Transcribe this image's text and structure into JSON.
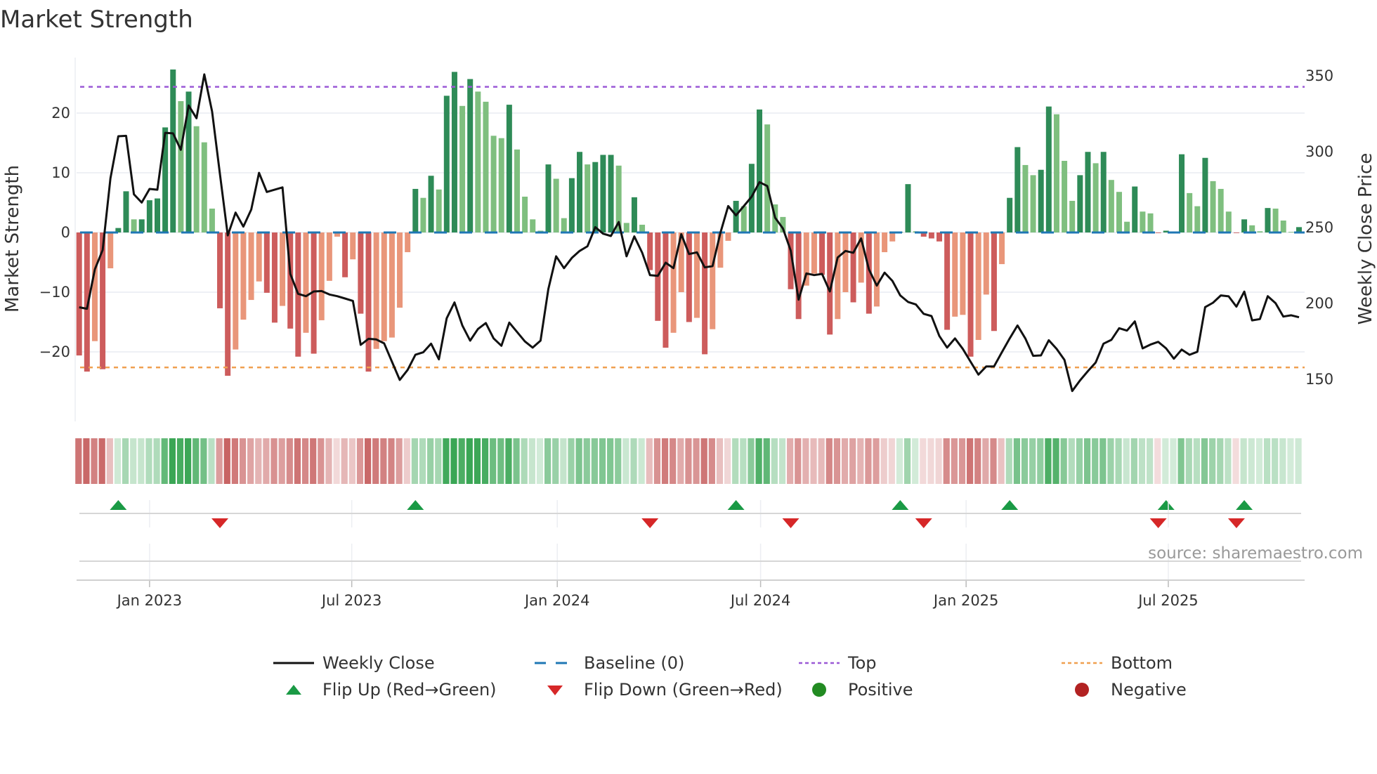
{
  "title": "Market Strength",
  "chart_data": {
    "type": "bar+line",
    "title": "Market Strength",
    "ylabel": "Market Strength",
    "y2label": "Weekly Close Price",
    "ylim": [
      -31.4,
      29.3
    ],
    "y2lim": [
      122.7,
      361.6
    ],
    "yticks": [
      {
        "v": 20,
        "label": "20"
      },
      {
        "v": 10,
        "label": "10"
      },
      {
        "v": 0,
        "label": "0"
      },
      {
        "v": -10,
        "label": "−10"
      },
      {
        "v": -20,
        "label": "−20"
      }
    ],
    "y2ticks": [
      {
        "v": 350,
        "label": "350"
      },
      {
        "v": 300,
        "label": "300"
      },
      {
        "v": 250,
        "label": "250"
      },
      {
        "v": 200,
        "label": "200"
      },
      {
        "v": 150,
        "label": "150"
      }
    ],
    "x_start": "2022-10-30",
    "x_step_days": 7,
    "xticks": [
      {
        "date": "2023-01-01",
        "label": "Jan 2023"
      },
      {
        "date": "2023-07-01",
        "label": "Jul 2023"
      },
      {
        "date": "2024-01-01",
        "label": "Jan 2024"
      },
      {
        "date": "2024-07-01",
        "label": "Jul 2024"
      },
      {
        "date": "2025-01-01",
        "label": "Jan 2025"
      },
      {
        "date": "2025-07-01",
        "label": "Jul 2025"
      }
    ],
    "top_level": 24.4,
    "bottom_level": -22.6,
    "baseline": 0,
    "strength": [
      -20.6,
      -23.3,
      -18.2,
      -22.9,
      -6.0,
      0.75,
      6.9,
      2.2,
      2.2,
      5.4,
      5.7,
      17.6,
      27.3,
      22.0,
      23.6,
      17.8,
      15.1,
      4.0,
      -12.7,
      -24.0,
      -19.6,
      -14.6,
      -11.3,
      -8.2,
      -10.1,
      -15.1,
      -12.3,
      -16.1,
      -20.8,
      -16.8,
      -20.3,
      -14.7,
      -8.1,
      -0.7,
      -7.5,
      -4.5,
      -13.6,
      -23.3,
      -19.5,
      -18.2,
      -17.6,
      -12.6,
      -3.3,
      7.3,
      5.8,
      9.5,
      7.2,
      22.9,
      26.9,
      21.2,
      25.7,
      23.6,
      21.9,
      16.2,
      15.8,
      21.4,
      13.9,
      6.0,
      2.2,
      0.3,
      11.4,
      9.0,
      2.4,
      9.1,
      13.5,
      11.4,
      11.8,
      13.0,
      13.0,
      11.2,
      1.6,
      5.9,
      1.3,
      -6.3,
      -14.8,
      -19.3,
      -16.8,
      -10.0,
      -15.0,
      -14.3,
      -20.4,
      -16.2,
      -5.9,
      -1.4,
      5.3,
      4.4,
      11.5,
      20.6,
      18.1,
      4.7,
      2.6,
      -9.5,
      -14.5,
      -8.9,
      -6.9,
      -7.1,
      -17.1,
      -14.5,
      -10.0,
      -11.7,
      -8.4,
      -13.6,
      -12.4,
      -3.3,
      -1.5,
      0.1,
      8.1,
      0.2,
      -0.7,
      -1.0,
      -1.5,
      -16.3,
      -14.1,
      -13.8,
      -20.8,
      -18.0,
      -10.4,
      -16.5,
      -5.3,
      5.8,
      14.3,
      11.3,
      9.6,
      10.5,
      21.1,
      19.8,
      12.0,
      5.3,
      9.6,
      13.5,
      11.6,
      13.5,
      8.8,
      6.8,
      1.8,
      7.7,
      3.5,
      3.2,
      -0.1,
      0.3,
      0.05,
      13.1,
      6.6,
      4.4,
      12.5,
      8.6,
      7.3,
      3.5,
      -0.1,
      2.2,
      1.2,
      0.2,
      4.1,
      4.0,
      2.0,
      0.1,
      0.9
    ],
    "weekly_close": [
      197,
      196,
      222,
      234.7,
      282,
      309.7,
      310,
      271.5,
      266,
      275,
      274.5,
      312,
      311.6,
      300.8,
      330,
      321.6,
      350.5,
      326,
      285,
      244.4,
      259.4,
      250.2,
      261.4,
      285.6,
      273,
      274.5,
      276,
      219,
      205.9,
      204.3,
      207.4,
      207.7,
      205.4,
      204.3,
      202.8,
      201.2,
      172.2,
      176.2,
      175.8,
      173.2,
      161.1,
      149.1,
      155.7,
      165.7,
      167.3,
      173,
      162.7,
      189.7,
      200.2,
      185,
      175,
      182.7,
      186.6,
      176.5,
      171.6,
      186.9,
      180.7,
      174.5,
      170.4,
      175,
      209,
      230.6,
      222.8,
      229.5,
      234.1,
      237.2,
      249.8,
      245.5,
      244,
      253.2,
      230.6,
      243.7,
      232.9,
      218.2,
      217.7,
      226.4,
      222.8,
      245.2,
      232.1,
      233.2,
      223.3,
      224.1,
      246,
      263.7,
      257.6,
      263.7,
      269.9,
      279.5,
      276.9,
      256,
      249,
      234.4,
      202,
      219.3,
      218.2,
      219,
      207.4,
      229.8,
      234.1,
      232.9,
      242.4,
      222,
      211.3,
      219.8,
      214.4,
      204.8,
      200.5,
      198.9,
      192.7,
      191.2,
      178.1,
      170.4,
      176.5,
      169.6,
      161.1,
      152.6,
      158,
      158,
      167.3,
      176.5,
      185,
      176.5,
      165,
      165.3,
      175.3,
      169.6,
      162.3,
      141.8,
      148.8,
      154.9,
      160.6,
      173,
      175.5,
      183.2,
      181.6,
      187.7,
      169.9,
      172.4,
      174.2,
      169.9,
      163.1,
      169.1,
      165.7,
      167.7,
      197.1,
      200,
      204.8,
      204.2,
      197.4,
      207.3,
      188.4,
      189.2,
      204.3,
      199.7,
      190.9,
      191.7,
      190.4
    ],
    "source": "source: sharemaestro.com",
    "legend": {
      "placement": "bottom",
      "items": [
        {
          "label": "Weekly Close",
          "icon": "line-swatch"
        },
        {
          "label": "Baseline (0)",
          "icon": "dashed-line-swatch"
        },
        {
          "label": "Top",
          "icon": "dotted-line-swatch"
        },
        {
          "label": "Bottom",
          "icon": "dotted-line-swatch"
        },
        {
          "label": "Flip Up (Red→Green)",
          "icon": "triangle-up-icon"
        },
        {
          "label": "Flip Down (Green→Red)",
          "icon": "triangle-down-icon"
        },
        {
          "label": "Positive",
          "icon": "circle-icon"
        },
        {
          "label": "Negative",
          "icon": "circle-icon"
        }
      ]
    },
    "colors": {
      "pos_strong": "#2e8b57",
      "pos_weak": "#7fbf7f",
      "neg_strong": "#cd5c5c",
      "neg_weak": "#e9967a",
      "line": "#111111",
      "baseline": "#1f77b4",
      "top": "#9b59d6",
      "bottom": "#f0a050",
      "flip_up": "#1a9a45",
      "flip_down": "#d62728",
      "positive": "#228b22",
      "negative": "#b22222"
    }
  }
}
